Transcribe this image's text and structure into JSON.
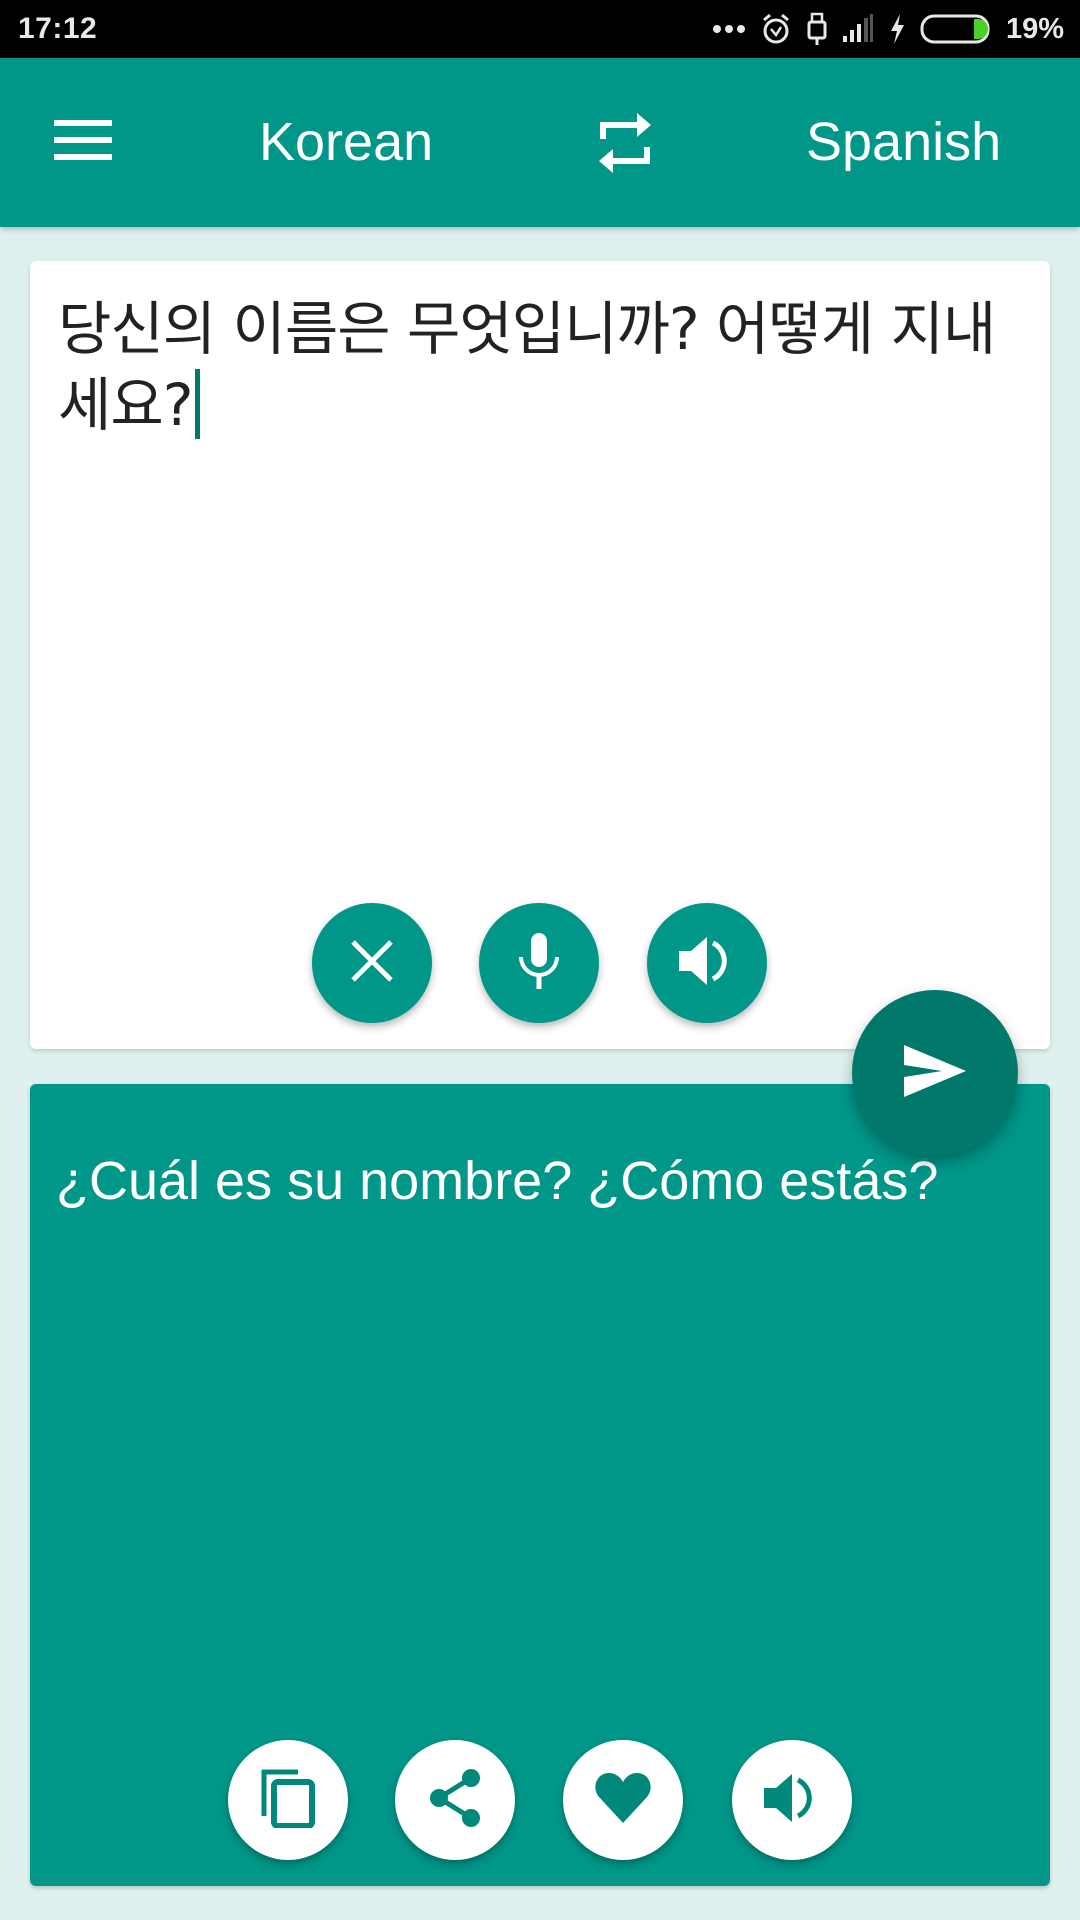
{
  "status_bar": {
    "time": "17:12",
    "battery_percent": "19%",
    "battery_level": 0.19,
    "icons": [
      "more-dots-icon",
      "alarm-icon",
      "usb-icon",
      "signal-icon",
      "charging-icon",
      "battery-icon"
    ]
  },
  "app_bar": {
    "menu_icon": "hamburger-menu-icon",
    "source_language": "Korean",
    "swap_icon": "swap-languages-icon",
    "target_language": "Spanish"
  },
  "input": {
    "text": "당신의 이름은 무엇입니까? 어떻게 지내세요?",
    "buttons": [
      {
        "name": "clear",
        "icon": "close-icon"
      },
      {
        "name": "microphone",
        "icon": "microphone-icon"
      },
      {
        "name": "speak",
        "icon": "speaker-icon"
      }
    ]
  },
  "translate_button": {
    "icon": "send-icon"
  },
  "output": {
    "text": "¿Cuál es su nombre? ¿Cómo estás?",
    "buttons": [
      {
        "name": "copy",
        "icon": "copy-icon"
      },
      {
        "name": "share",
        "icon": "share-icon"
      },
      {
        "name": "favorite",
        "icon": "heart-icon"
      },
      {
        "name": "speak",
        "icon": "speaker-icon"
      }
    ]
  },
  "colors": {
    "primary": "#009688",
    "primary_dark": "#00796B",
    "background": "#DFF1EE",
    "battery_green": "#4CD12B"
  }
}
